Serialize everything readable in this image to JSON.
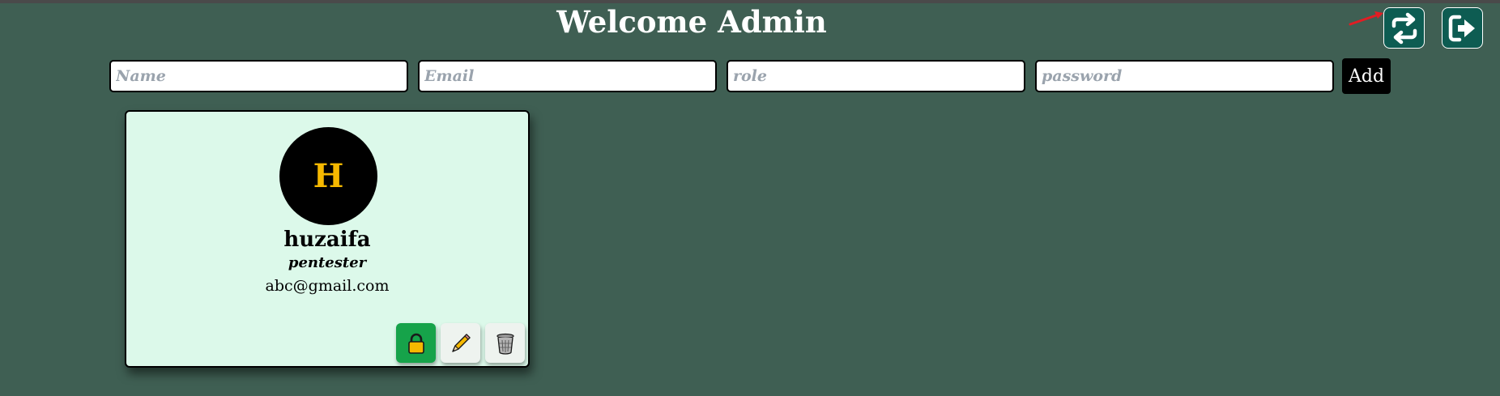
{
  "header": {
    "title": "Welcome Admin",
    "refresh_icon": "refresh-swap-icon",
    "logout_icon": "logout-icon",
    "accent_color": "#0d5c52",
    "background_color": "#3f5f53"
  },
  "form": {
    "name_placeholder": "Name",
    "email_placeholder": "Email",
    "role_placeholder": "role",
    "password_placeholder": "password",
    "add_label": "Add"
  },
  "users": [
    {
      "initial": "H",
      "name": "huzaifa",
      "role": "pentester",
      "email": "abc@gmail.com",
      "actions": {
        "lock_icon": "lock-icon",
        "edit_icon": "pencil-icon",
        "delete_icon": "trash-icon",
        "lock_color": "#16a34a"
      }
    }
  ]
}
